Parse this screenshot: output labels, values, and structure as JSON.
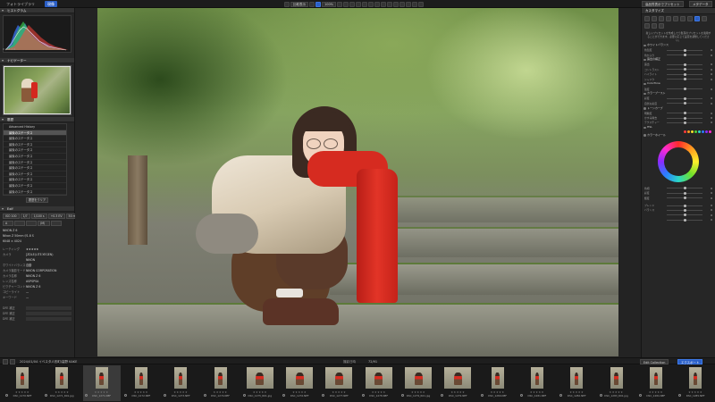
{
  "tabs": [
    {
      "label": "フォトライブラリ",
      "active": false
    },
    {
      "label": "現像",
      "active": true
    }
  ],
  "toolbar": {
    "compare_label": "比較表示",
    "zoom_label": "100%",
    "right_tools": [
      "高品質表示でプリセット",
      "メタデータ"
    ]
  },
  "left_panel": {
    "histogram": {
      "title": "ヒストグラム",
      "readout": "0    255   0   0"
    },
    "navigator": {
      "title": "ナビゲーター"
    },
    "history": {
      "title": "履歴",
      "items": [
        "Advanced History",
        "最後のステータス",
        "最後のステータス",
        "最後のステータス",
        "最後のステータス",
        "最後のステータス",
        "最後のステータス",
        "最後のステータス",
        "最後のステータス",
        "最後のステータス",
        "最後のステータス",
        "最後のステータス"
      ],
      "clear_button": "履歴をクリア"
    },
    "exif": {
      "title": "Exif",
      "chips": [
        "ISO 100",
        "1/7",
        "1/100 s",
        "+0.3 EV",
        "50 mm"
      ],
      "mode_chips": [
        "A",
        "",
        "",
        "(M)",
        ""
      ],
      "camera": "NIKON Z 6",
      "lens": "Nikon Z 50mm f/1.8 S",
      "dims": "6048 × 4024",
      "rows": [
        {
          "k": "レーティング",
          "v": "★★★★★"
        },
        {
          "k": "カメラ",
          "v": "[ZDLE(LITE-YEGEN)"
        },
        {
          "k": "",
          "v": "NIKON"
        },
        {
          "k": "ホワイトバランス",
          "v": "自動"
        },
        {
          "k": "カメラ撮影モード",
          "v": "NIKON CORPORATION"
        },
        {
          "k": "カメラ名称",
          "v": "NIKON Z 6"
        },
        {
          "k": "レンズ名称",
          "v": "ASPSPSA"
        },
        {
          "k": "ピクチャーコントロール",
          "v": "NIKON Z 6"
        },
        {
          "k": "コピーライト",
          "v": "—"
        },
        {
          "k": "キーワード",
          "v": "—"
        }
      ]
    },
    "footer_labels": [
      "DFE 補正",
      "DFE 補正",
      "DFE 補正"
    ]
  },
  "right_panel": {
    "title": "カスタマイズ",
    "help_text": "新しいプリセットを作成したり既存のプリセットを適用することができます。必要に応じて設定を調整してください。",
    "sections": [
      {
        "title": "ホワイトバランス",
        "sliders": [
          {
            "label": "色温度",
            "value": "0"
          },
          {
            "label": "色かぶり",
            "value": "0"
          }
        ]
      },
      {
        "title": "露出の補正",
        "sliders": [
          {
            "label": "露出",
            "value": "0"
          },
          {
            "label": "コントラスト",
            "value": "0"
          },
          {
            "label": "ハイライト",
            "value": "0"
          },
          {
            "label": "シャドウ",
            "value": "0"
          }
        ]
      },
      {
        "title": "ColorTone",
        "sliders": [
          {
            "label": "強度",
            "value": "0"
          }
        ]
      },
      {
        "title": "カラーブースト",
        "sliders": [
          {
            "label": "彩度",
            "value": "0"
          },
          {
            "label": "自然な彩度",
            "value": "0"
          }
        ]
      },
      {
        "title": "トーンカーブ",
        "sliders": [
          {
            "label": "明瞭度",
            "value": "0"
          },
          {
            "label": "かすみ除去",
            "value": "0"
          },
          {
            "label": "テクスチャー",
            "value": "0"
          }
        ]
      },
      {
        "title": "HSL",
        "sliders": []
      }
    ],
    "wheel_label": "カラーホイール",
    "wheel_sliders": [
      {
        "label": "色相",
        "value": "0"
      },
      {
        "label": "彩度",
        "value": "0"
      },
      {
        "label": "輝度",
        "value": "0"
      }
    ],
    "bottom_sliders": [
      {
        "label": "ブレンド",
        "value": "0"
      },
      {
        "label": "バランス",
        "value": "0"
      },
      {
        "label": "",
        "value": "0"
      },
      {
        "label": "",
        "value": "0"
      }
    ],
    "swatch_colors": [
      "#ff3b3b",
      "#ff9a1f",
      "#f2e22b",
      "#4fd23a",
      "#2bd6c7",
      "#2b7dff",
      "#8a2bff",
      "#ff2bd0"
    ]
  },
  "filmstrip_bar": {
    "path": "2024/01/04 イベスタ人形町/高野 KAKE",
    "sort": "撮影日時",
    "count": "72/91",
    "buttons": [
      "Edit Collection",
      "エクスポート"
    ]
  },
  "filmstrip": {
    "frames": [
      {
        "name": "DSC_1270.NEF",
        "portrait": true,
        "selected": false
      },
      {
        "name": "DSC_1271_R01.jpg",
        "portrait": true,
        "selected": false
      },
      {
        "name": "DSC_1271.NEF",
        "portrait": true,
        "selected": true
      },
      {
        "name": "DSC_1272.NEF",
        "portrait": true,
        "selected": false
      },
      {
        "name": "DSC_1273.NEF",
        "portrait": true,
        "selected": false
      },
      {
        "name": "DSC_1274.NEF",
        "portrait": true,
        "selected": false
      },
      {
        "name": "DSC_1275_R01.jpg",
        "portrait": false,
        "selected": false
      },
      {
        "name": "DSC_1276.NEF",
        "portrait": false,
        "selected": false
      },
      {
        "name": "DSC_1277.NEF",
        "portrait": false,
        "selected": false
      },
      {
        "name": "DSC_1278.NEF",
        "portrait": false,
        "selected": false
      },
      {
        "name": "DSC_1279_R01.jpg",
        "portrait": false,
        "selected": false
      },
      {
        "name": "DSC_1279.NEF",
        "portrait": false,
        "selected": false
      },
      {
        "name": "DSC_1280.NEF",
        "portrait": true,
        "selected": false
      },
      {
        "name": "DSC_1281.NEF",
        "portrait": true,
        "selected": false
      },
      {
        "name": "DSC_1282.NEF",
        "portrait": true,
        "selected": false
      },
      {
        "name": "DSC_1283_R01.jpg",
        "portrait": true,
        "selected": false
      },
      {
        "name": "DSC_1284.NEF",
        "portrait": true,
        "selected": false
      },
      {
        "name": "DSC_1285.NEF",
        "portrait": true,
        "selected": false
      }
    ]
  }
}
